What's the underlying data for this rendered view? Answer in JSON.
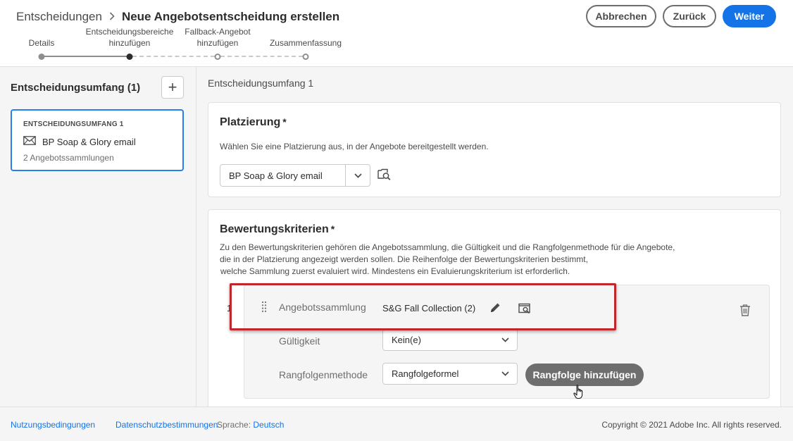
{
  "breadcrumb": {
    "root": "Entscheidungen",
    "current": "Neue Angebotsentscheidung erstellen"
  },
  "header_buttons": {
    "cancel": "Abbrechen",
    "back": "Zurück",
    "next": "Weiter"
  },
  "stepper": {
    "steps": [
      {
        "line1": "",
        "line2": "Details",
        "state": "done"
      },
      {
        "line1": "Entscheidungsbereiche",
        "line2": "hinzufügen",
        "state": "current"
      },
      {
        "line1": "Fallback-Angebot",
        "line2": "hinzufügen",
        "state": "todo"
      },
      {
        "line1": "",
        "line2": "Zusammenfassung",
        "state": "todo"
      }
    ]
  },
  "left_panel": {
    "title": "Entscheidungsumfang (1)",
    "add_label": "+",
    "card": {
      "heading": "ENTSCHEIDUNGSUMFANG 1",
      "name": "BP Soap & Glory email",
      "collections": "2 Angebotssammlungen"
    }
  },
  "main": {
    "title": "Entscheidungsumfang 1",
    "placement": {
      "title": "Platzierung",
      "required": "*",
      "description": "Wählen Sie eine Platzierung aus, in der Angebote bereitgestellt werden.",
      "selected": "BP Soap & Glory email"
    },
    "criteria": {
      "title": "Bewertungskriterien",
      "required": "*",
      "description": [
        "Zu den Bewertungskriterien gehören die Angebotssammlung, die Gültigkeit und die Rangfolgenmethode für die Angebote,",
        "die in der Platzierung angezeigt werden sollen. Die Reihenfolge der Bewertungskriterien bestimmt,",
        "welche Sammlung zuerst evaluiert wird. Mindestens ein Evaluierungskriterium ist erforderlich."
      ],
      "row": {
        "index": "1",
        "collection_label": "Angebotssammlung",
        "collection_value": "S&G Fall Collection (2)",
        "validity_label": "Gültigkeit",
        "validity_value": "Kein(e)",
        "ranking_label": "Rangfolgenmethode",
        "ranking_value": "Rangfolgeformel",
        "add_ranking_button": "Rangfolge hinzufügen"
      }
    }
  },
  "footer": {
    "terms": "Nutzungsbedingungen",
    "privacy": "Datenschutzbestimmungen",
    "language_label": "Sprache:",
    "language_value": "Deutsch",
    "copyright": "Copyright ©  2021 Adobe Inc. All rights reserved."
  },
  "colors": {
    "accent": "#1473e6",
    "selected_border": "#2680eb",
    "highlight": "#c0272d",
    "secondary_button": "#6e6e6e"
  }
}
